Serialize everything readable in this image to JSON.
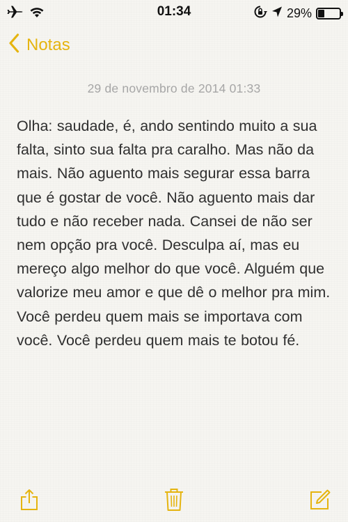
{
  "status_bar": {
    "time": "01:34",
    "battery_percent_text": "29%",
    "battery_level": 0.29,
    "icons": [
      "airplane-icon",
      "wifi-icon",
      "rotation-lock-icon",
      "location-arrow-icon",
      "battery-icon"
    ]
  },
  "nav": {
    "back_label": "Notas",
    "accent_color": "#e5b40f"
  },
  "note": {
    "date": "29 de novembro de 2014 01:33",
    "body": "Olha: saudade, é, ando sentindo muito a sua falta, sinto sua falta pra caralho. Mas não da mais. Não aguento mais segurar essa barra que é gostar de você. Não aguento mais dar tudo e não receber nada. Cansei de não ser nem opção pra você. Desculpa aí, mas eu mereço algo melhor do que você. Alguém que valorize meu amor e que dê o melhor pra mim. Você perdeu quem mais se importava com você. Você perdeu quem mais te botou fé."
  },
  "toolbar": {
    "icons": [
      "share-icon",
      "trash-icon",
      "compose-icon"
    ]
  }
}
